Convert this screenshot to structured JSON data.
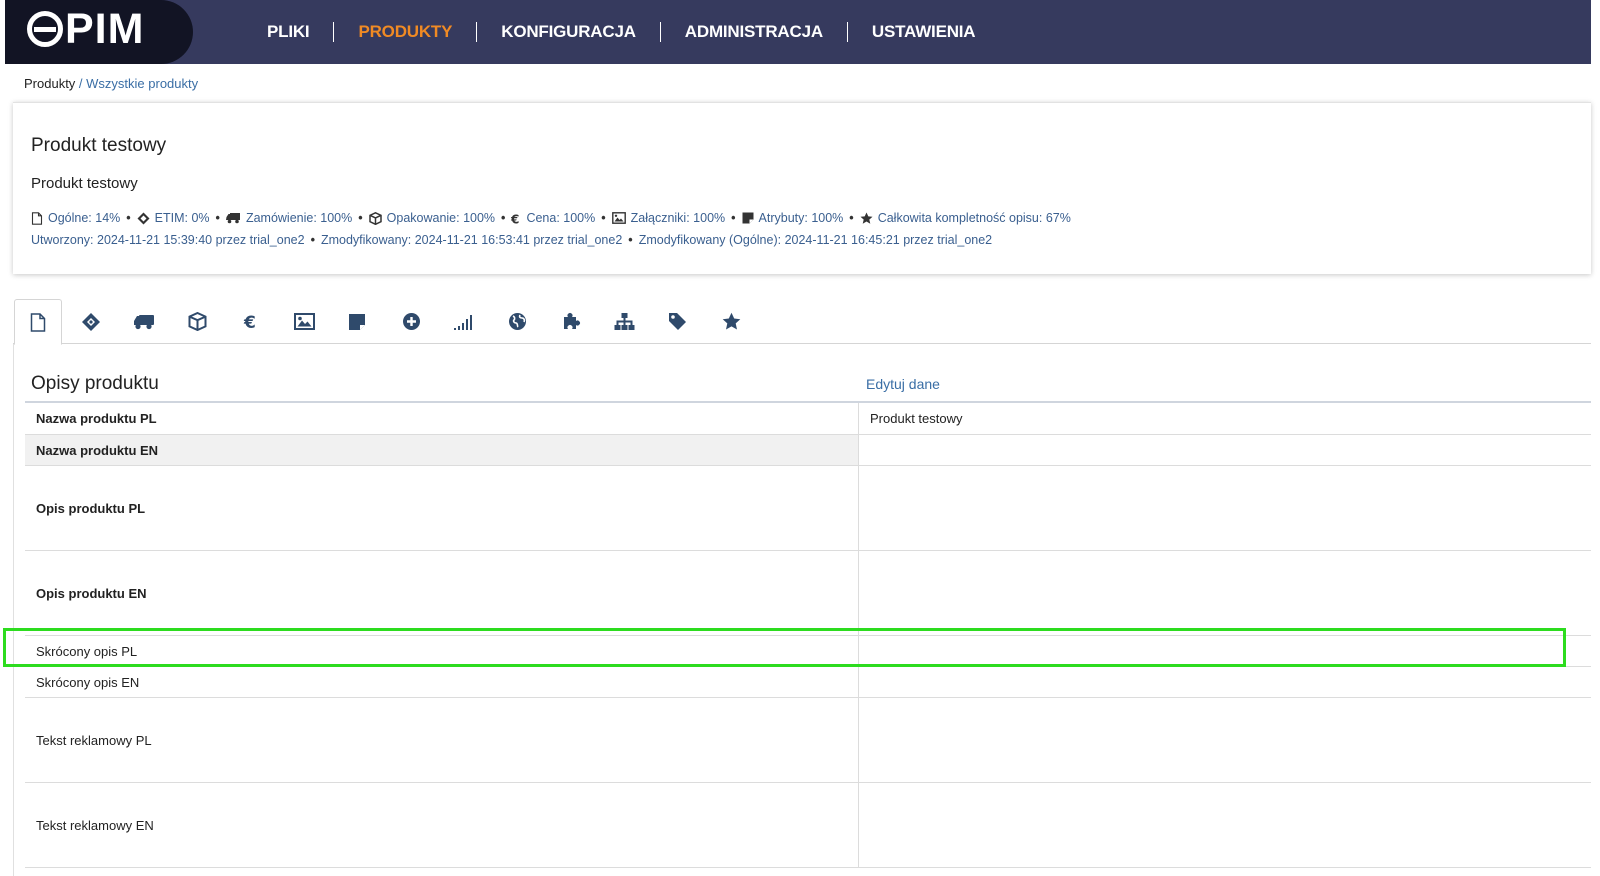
{
  "app": {
    "logo": "ePIM"
  },
  "nav": {
    "items": [
      {
        "label": "PLIKI",
        "active": false
      },
      {
        "label": "PRODUKTY",
        "active": true
      },
      {
        "label": "KONFIGURACJA",
        "active": false
      },
      {
        "label": "ADMINISTRACJA",
        "active": false
      },
      {
        "label": "USTAWIENIA",
        "active": false
      }
    ]
  },
  "breadcrumb": {
    "root": "Produkty",
    "separator": " / ",
    "current": "Wszystkie produkty"
  },
  "product": {
    "title": "Produkt testowy",
    "subtitle": "Produkt testowy",
    "stats": [
      {
        "icon": "file-icon",
        "text": "Ogólne: 14%"
      },
      {
        "icon": "etim-icon",
        "text": "ETIM: 0%"
      },
      {
        "icon": "truck-icon",
        "text": "Zamówienie: 100%"
      },
      {
        "icon": "box-icon",
        "text": "Opakowanie: 100%"
      },
      {
        "icon": "euro-icon",
        "text": "Cena: 100%"
      },
      {
        "icon": "image-icon",
        "text": "Załączniki: 100%"
      },
      {
        "icon": "note-icon",
        "text": "Atrybuty: 100%"
      },
      {
        "icon": "star-icon",
        "text": "Całkowita kompletność opisu: 67%"
      }
    ],
    "meta": {
      "created": "Utworzony: 2024-11-21 15:39:40 przez trial_one2",
      "modified": "Zmodyfikowany: 2024-11-21 16:53:41 przez trial_one2",
      "modified_general": "Zmodyfikowany (Ogólne): 2024-11-21 16:45:21 przez trial_one2"
    }
  },
  "tabs": [
    {
      "icon": "file-icon",
      "active": true
    },
    {
      "icon": "etim-icon"
    },
    {
      "icon": "truck-icon"
    },
    {
      "icon": "box-icon"
    },
    {
      "icon": "euro-icon"
    },
    {
      "icon": "image-icon"
    },
    {
      "icon": "note-icon"
    },
    {
      "icon": "plus-circle-icon"
    },
    {
      "icon": "signal-icon"
    },
    {
      "icon": "globe-icon"
    },
    {
      "icon": "puzzle-icon"
    },
    {
      "icon": "sitemap-icon"
    },
    {
      "icon": "tag-icon"
    },
    {
      "icon": "star-icon"
    }
  ],
  "section": {
    "title": "Opisy produktu",
    "edit_label": "Edytuj dane"
  },
  "rows": [
    {
      "label": "Nazwa produktu PL",
      "value": "Produkt testowy"
    },
    {
      "label": "Nazwa produktu EN",
      "value": ""
    },
    {
      "label": "Opis produktu PL",
      "value": ""
    },
    {
      "label": "Opis produktu EN",
      "value": ""
    },
    {
      "label": "Skrócony opis PL",
      "value": ""
    },
    {
      "label": "Skrócony opis EN",
      "value": ""
    },
    {
      "label": "Tekst reklamowy PL",
      "value": ""
    },
    {
      "label": "Tekst reklamowy EN",
      "value": ""
    }
  ],
  "colors": {
    "nav_bg": "#363a5e",
    "logo_bg": "#121424",
    "nav_active": "#f08a24",
    "link": "#3a6ea5",
    "highlight": "#2ddc1f"
  }
}
